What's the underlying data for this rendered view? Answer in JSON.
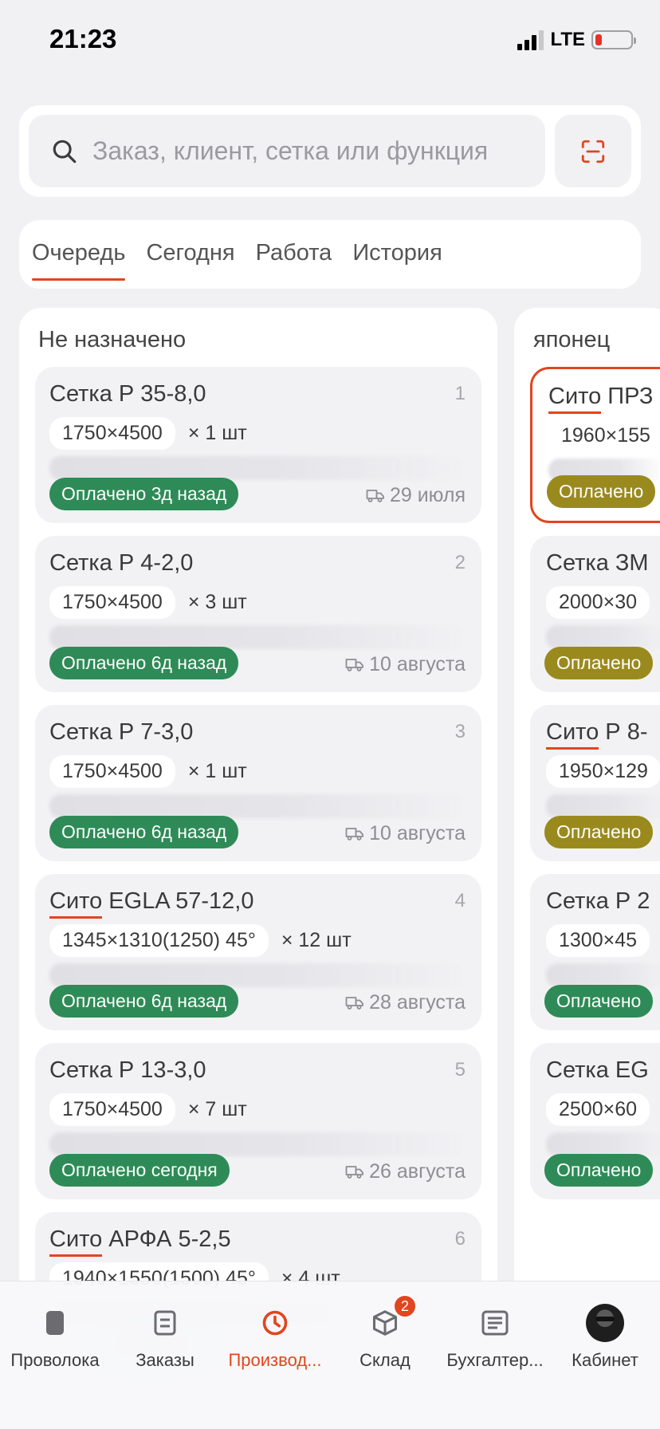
{
  "status_bar": {
    "time": "21:23",
    "network": "LTE"
  },
  "search": {
    "placeholder": "Заказ, клиент, сетка или функция"
  },
  "tabs": [
    {
      "label": "Очередь",
      "active": true
    },
    {
      "label": "Сегодня",
      "active": false
    },
    {
      "label": "Работа",
      "active": false
    },
    {
      "label": "История",
      "active": false
    }
  ],
  "columns": [
    {
      "title": "Не назначено",
      "cards": [
        {
          "kind": "Сетка",
          "name": "Р 35-8,0",
          "num": "1",
          "dims": "1750×4500",
          "qty": "× 1 шт",
          "badge": "Оплачено 3д назад",
          "date": "29 июля"
        },
        {
          "kind": "Сетка",
          "name": "Р 4-2,0",
          "num": "2",
          "dims": "1750×4500",
          "qty": "× 3 шт",
          "badge": "Оплачено 6д назад",
          "date": "10 августа"
        },
        {
          "kind": "Сетка",
          "name": "Р 7-3,0",
          "num": "3",
          "dims": "1750×4500",
          "qty": "× 1 шт",
          "badge": "Оплачено 6д назад",
          "date": "10 августа"
        },
        {
          "kind": "Сито",
          "name": "EGLA 57-12,0",
          "num": "4",
          "dims": "1345×1310(1250) 45°",
          "qty": "× 12 шт",
          "badge": "Оплачено 6д назад",
          "date": "28 августа"
        },
        {
          "kind": "Сетка",
          "name": "Р 13-3,0",
          "num": "5",
          "dims": "1750×4500",
          "qty": "× 7 шт",
          "badge": "Оплачено сегодня",
          "date": "26 августа"
        },
        {
          "kind": "Сито",
          "name": "АРФА 5-2,5",
          "num": "6",
          "dims": "1940×1550(1500) 45°",
          "qty": "× 4 шт",
          "badge": "",
          "date": ""
        }
      ]
    },
    {
      "title": "японец",
      "cards": [
        {
          "kind": "Сито",
          "name": "ПРЗ",
          "dims": "1960×155",
          "badge": "Оплачено",
          "highlight": true,
          "olive": true
        },
        {
          "kind": "Сетка",
          "name": "ЗМ",
          "dims": "2000×30",
          "badge": "Оплачено",
          "olive": true
        },
        {
          "kind": "Сито",
          "name": "Р 8-",
          "dims": "1950×129",
          "badge": "Оплачено",
          "olive": true
        },
        {
          "kind": "Сетка",
          "name": "Р 2",
          "dims": "1300×45",
          "badge": "Оплачено",
          "olive": false
        },
        {
          "kind": "Сетка",
          "name": "EG",
          "dims": "2500×60",
          "badge": "Оплачено",
          "olive": false
        }
      ]
    }
  ],
  "tabbar": [
    {
      "label": "Проволока",
      "icon": "wire-spool-icon",
      "active": false
    },
    {
      "label": "Заказы",
      "icon": "orders-icon",
      "active": false
    },
    {
      "label": "Производ...",
      "icon": "clock-icon",
      "active": true
    },
    {
      "label": "Склад",
      "icon": "box-icon",
      "active": false,
      "badge": "2"
    },
    {
      "label": "Бухгалтер...",
      "icon": "ledger-icon",
      "active": false
    },
    {
      "label": "Кабинет",
      "icon": "avatar",
      "active": false
    }
  ],
  "colors": {
    "accent": "#e0461f",
    "paid": "#2e8b57",
    "paid_olive": "#9a8a1e"
  }
}
